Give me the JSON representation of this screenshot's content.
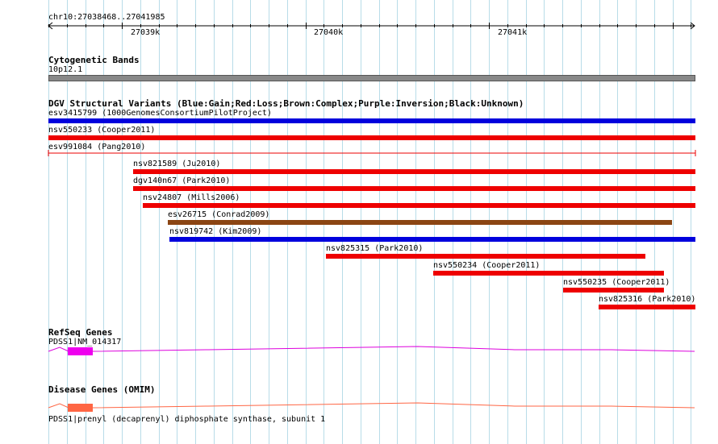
{
  "ruler": {
    "region": "chr10:27038468..27041985",
    "ticks": [
      "27039k",
      "27040k",
      "27041k"
    ]
  },
  "cytobands": {
    "title": "Cytogenetic Bands",
    "band": "10p12.1"
  },
  "dgv": {
    "title": "DGV Structural Variants (Blue:Gain;Red:Loss;Brown:Complex;Purple:Inversion;Black:Unknown)",
    "variants": [
      {
        "label": "esv3415799 (1000GenomesConsortiumPilotProject)",
        "color": "#0000dd"
      },
      {
        "label": "nsv550233 (Cooper2011)",
        "color": "#ee0000"
      },
      {
        "label": "esv991084 (Pang2010)",
        "color": "#ee0000"
      },
      {
        "label": "nsv821589 (Ju2010)",
        "color": "#ee0000"
      },
      {
        "label": "dgv140n67 (Park2010)",
        "color": "#ee0000"
      },
      {
        "label": "nsv24807 (Mills2006)",
        "color": "#ee0000"
      },
      {
        "label": "esv26715 (Conrad2009)",
        "color": "#8b4513"
      },
      {
        "label": "nsv819742 (Kim2009)",
        "color": "#0000dd"
      },
      {
        "label": "nsv825315 (Park2010)",
        "color": "#ee0000"
      },
      {
        "label": "nsv550234 (Cooper2011)",
        "color": "#ee0000"
      },
      {
        "label": "nsv550235 (Cooper2011)",
        "color": "#ee0000"
      },
      {
        "label": "nsv825316 (Park2010)",
        "color": "#ee0000"
      }
    ]
  },
  "refseq": {
    "title": "RefSeq Genes",
    "gene": "PDSS1|NM_014317",
    "color": "#dd00dd"
  },
  "omim": {
    "title": "Disease Genes (OMIM)",
    "gene": "PDSS1|prenyl (decaprenyl) diphosphate synthase, subunit 1",
    "color": "#ff6644"
  }
}
